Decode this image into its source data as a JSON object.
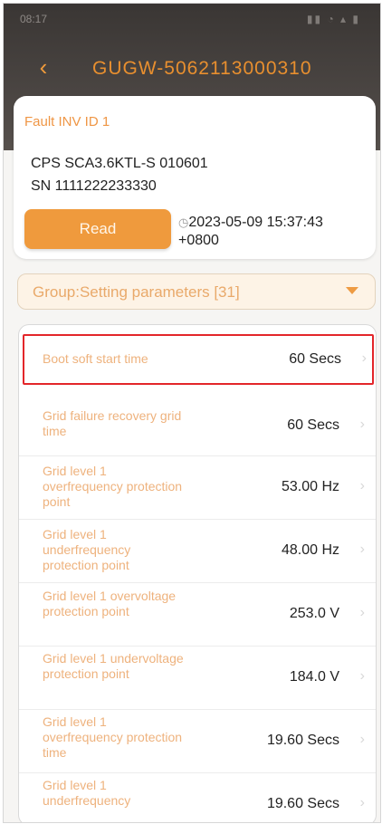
{
  "status_bar": {
    "time": "08:17",
    "icons": "▮▮ ◔ ▴ ▮"
  },
  "header": {
    "back_icon": "chevron-left-icon",
    "title": "GUGW-5062113000310"
  },
  "info": {
    "fault_label": "Fault INV ID 1",
    "model": "CPS SCA3.6KTL-S 010601",
    "sn": "SN 1111222233330",
    "read_button": "Read",
    "read_time_line1": "2023-05-09 15:37:43",
    "read_time_line2": "+0800"
  },
  "group_select": {
    "label": "Group:Setting parameters [31]"
  },
  "params": [
    {
      "label": "Boot soft start time",
      "value": "60 Secs"
    },
    {
      "label": "Grid failure recovery grid time",
      "value": "60 Secs"
    },
    {
      "label": "Grid level 1 overfrequency protection point",
      "value": "53.00 Hz"
    },
    {
      "label": "Grid level 1 underfrequency protection point",
      "value": "48.00 Hz"
    },
    {
      "label": "Grid level 1 overvoltage protection point",
      "value": "253.0 V"
    },
    {
      "label": "Grid level 1 undervoltage protection point",
      "value": "184.0 V"
    },
    {
      "label": "Grid level 1 overfrequency protection time",
      "value": "19.60 Secs"
    },
    {
      "label": "Grid level 1 underfrequency",
      "value": "19.60 Secs"
    }
  ],
  "colors": {
    "accent": "#ef9a3d",
    "highlight": "#e3262a"
  }
}
